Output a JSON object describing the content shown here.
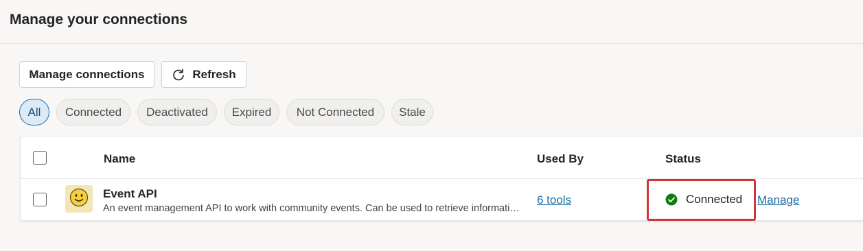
{
  "header": {
    "title": "Manage your connections"
  },
  "toolbar": {
    "manage_label": "Manage connections",
    "refresh_label": "Refresh"
  },
  "filters": [
    {
      "label": "All",
      "active": true
    },
    {
      "label": "Connected",
      "active": false
    },
    {
      "label": "Deactivated",
      "active": false
    },
    {
      "label": "Expired",
      "active": false
    },
    {
      "label": "Not Connected",
      "active": false
    },
    {
      "label": "Stale",
      "active": false
    }
  ],
  "table": {
    "columns": [
      "Name",
      "Used By",
      "Status"
    ],
    "rows": [
      {
        "icon": "smiley-icon",
        "name": "Event API",
        "description": "An event management API to work with community events. Can be used to retrieve information about community events.",
        "used_by": "6 tools",
        "status": "Connected",
        "action": "Manage"
      }
    ]
  },
  "colors": {
    "accent": "#1c6ea4",
    "success": "#107c10",
    "highlight": "#d13438"
  }
}
